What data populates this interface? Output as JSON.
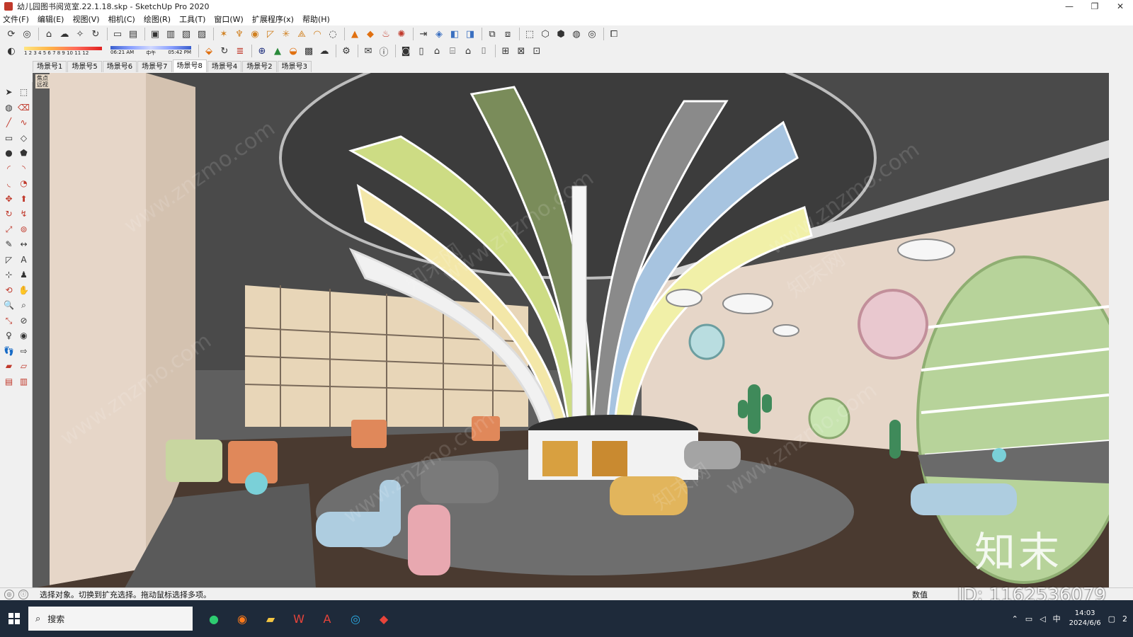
{
  "window": {
    "title": "幼儿园图书阅览室.22.1.18.skp - SketchUp Pro 2020",
    "controls": [
      "—",
      "❐",
      "✕"
    ]
  },
  "menu": [
    "文件(F)",
    "编辑(E)",
    "视图(V)",
    "相机(C)",
    "绘图(R)",
    "工具(T)",
    "窗口(W)",
    "扩展程序(x)",
    "帮助(H)"
  ],
  "shadow": {
    "months": "1 2 3 4 5 6 7 8 9 10 11 12",
    "time_start": "06:21 AM",
    "time_mid": "中午",
    "time_end": "05:42 PM"
  },
  "scenes": {
    "tabs": [
      "场景号1",
      "场景号5",
      "场景号6",
      "场景号7",
      "场景号8",
      "场景号4",
      "场景号2",
      "场景号3"
    ],
    "active_index": 4
  },
  "viewport": {
    "corner_label": "焦点 远视",
    "watermark": "www.znzmo.com",
    "watermark2": "知末网",
    "brand": "知末"
  },
  "status": {
    "message": "选择对象。切换到扩充选择。拖动鼠标选择多项。",
    "measure_label": "数值",
    "id_label": "ID: 1162536079"
  },
  "taskbar": {
    "search_placeholder": "搜索",
    "apps": [
      "wechat",
      "firefox",
      "folder",
      "wps",
      "acrobat",
      "edge",
      "sketchup"
    ],
    "tray_lang": "中",
    "time": "14:03",
    "date": "2024/6/6",
    "notif": "2"
  },
  "colors": {
    "ceiling": "#4a4a4a",
    "wall": "#e6d6c8",
    "floor": "#4a3a30",
    "shelf_wood": "#e8d6b8",
    "accent_green": "#b7d39a"
  }
}
